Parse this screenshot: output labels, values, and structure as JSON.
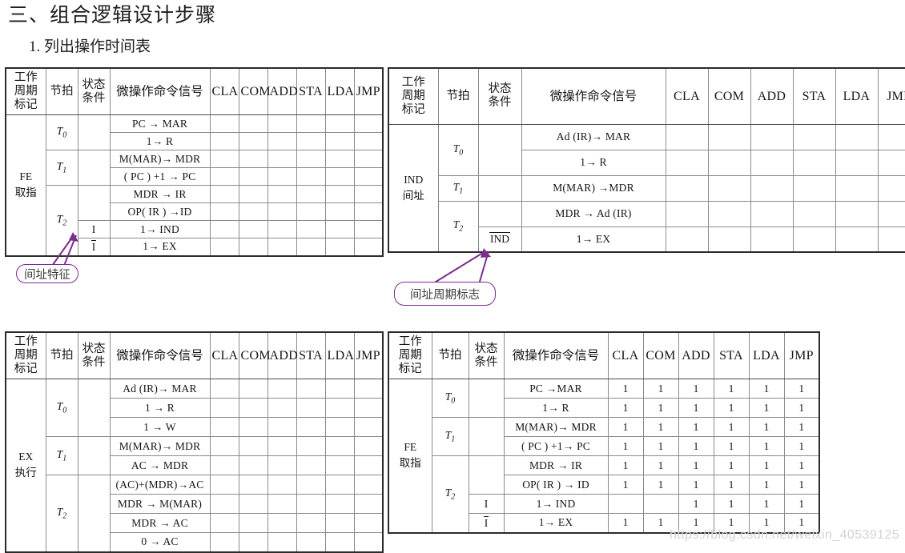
{
  "headings": {
    "main": "三、组合逻辑设计步骤",
    "sub": "1. 列出操作时间表"
  },
  "watermark": "https://blog.csdn.net/weixin_40539125",
  "accent_color": "#7b2d8e",
  "beat_color": "#2240c8",
  "common_headers": {
    "cycle": "工作\n周期\n标记",
    "cycle_l1": "工作",
    "cycle_l2": "周期",
    "cycle_l3": "标记",
    "beat": "节拍",
    "cond_l1": "状态",
    "cond_l2": "条件",
    "signal": "微操作命令信号",
    "instructions": [
      "CLA",
      "COM",
      "ADD",
      "STA",
      "LDA",
      "JMP"
    ]
  },
  "tables": [
    {
      "id": "fe-blank",
      "cycle_label_l1": "FE",
      "cycle_label_l2": "取指",
      "beats": [
        {
          "beat": "T",
          "beat_sub": "0",
          "rows": [
            {
              "cond": "",
              "signal": "PC → MAR",
              "values": [
                "",
                "",
                "",
                "",
                "",
                ""
              ]
            },
            {
              "cond": "",
              "signal": "1→ R",
              "values": [
                "",
                "",
                "",
                "",
                "",
                ""
              ]
            }
          ]
        },
        {
          "beat": "T",
          "beat_sub": "1",
          "rows": [
            {
              "cond": "",
              "signal": "M(MAR)→ MDR",
              "values": [
                "",
                "",
                "",
                "",
                "",
                ""
              ]
            },
            {
              "cond": "",
              "signal": "( PC ) +1 → PC",
              "values": [
                "",
                "",
                "",
                "",
                "",
                ""
              ]
            }
          ]
        },
        {
          "beat": "T",
          "beat_sub": "2",
          "rows": [
            {
              "cond": "",
              "signal": "MDR → IR",
              "values": [
                "",
                "",
                "",
                "",
                "",
                ""
              ]
            },
            {
              "cond": "",
              "signal": "OP( IR ) →ID",
              "values": [
                "",
                "",
                "",
                "",
                "",
                ""
              ]
            },
            {
              "cond": "I",
              "signal": "1→ IND",
              "values": [
                "",
                "",
                "",
                "",
                "",
                ""
              ]
            },
            {
              "cond": "I",
              "cond_overline": true,
              "signal": "1→ EX",
              "values": [
                "",
                "",
                "",
                "",
                "",
                ""
              ]
            }
          ]
        }
      ]
    },
    {
      "id": "ind-blank",
      "cycle_label_l1": "IND",
      "cycle_label_l2": "间址",
      "beats": [
        {
          "beat": "T",
          "beat_sub": "0",
          "rows": [
            {
              "cond": "",
              "signal": "Ad (IR)→ MAR",
              "values": [
                "",
                "",
                "",
                "",
                "",
                ""
              ]
            },
            {
              "cond": "",
              "signal": "1→ R",
              "values": [
                "",
                "",
                "",
                "",
                "",
                ""
              ]
            }
          ]
        },
        {
          "beat": "T",
          "beat_sub": "1",
          "rows": [
            {
              "cond": "",
              "signal": "M(MAR) →MDR",
              "values": [
                "",
                "",
                "",
                "",
                "",
                ""
              ]
            }
          ]
        },
        {
          "beat": "T",
          "beat_sub": "2",
          "rows": [
            {
              "cond": "",
              "signal": "MDR → Ad (IR)",
              "values": [
                "",
                "",
                "",
                "",
                "",
                ""
              ]
            },
            {
              "cond": "IND",
              "cond_overline": true,
              "signal": "1→ EX",
              "values": [
                "",
                "",
                "",
                "",
                "",
                ""
              ]
            }
          ]
        }
      ]
    },
    {
      "id": "ex-blank",
      "cycle_label_l1": "EX",
      "cycle_label_l2": "执行",
      "beats": [
        {
          "beat": "T",
          "beat_sub": "0",
          "rows": [
            {
              "cond": "",
              "signal": "Ad (IR)→ MAR",
              "values": [
                "",
                "",
                "",
                "",
                "",
                ""
              ]
            },
            {
              "cond": "",
              "signal": "1 → R",
              "values": [
                "",
                "",
                "",
                "",
                "",
                ""
              ]
            },
            {
              "cond": "",
              "signal": "1 → W",
              "values": [
                "",
                "",
                "",
                "",
                "",
                ""
              ]
            }
          ]
        },
        {
          "beat": "T",
          "beat_sub": "1",
          "rows": [
            {
              "cond": "",
              "signal": "M(MAR)→ MDR",
              "values": [
                "",
                "",
                "",
                "",
                "",
                ""
              ]
            },
            {
              "cond": "",
              "signal": "AC → MDR",
              "values": [
                "",
                "",
                "",
                "",
                "",
                ""
              ]
            }
          ]
        },
        {
          "beat": "T",
          "beat_sub": "2",
          "rows": [
            {
              "cond": "",
              "signal": "(AC)+(MDR)→AC",
              "values": [
                "",
                "",
                "",
                "",
                "",
                ""
              ]
            },
            {
              "cond": "",
              "signal": "MDR → M(MAR)",
              "values": [
                "",
                "",
                "",
                "",
                "",
                ""
              ]
            },
            {
              "cond": "",
              "signal": "MDR → AC",
              "values": [
                "",
                "",
                "",
                "",
                "",
                ""
              ]
            },
            {
              "cond": "",
              "signal": "0 → AC",
              "values": [
                "",
                "",
                "",
                "",
                "",
                ""
              ]
            }
          ]
        }
      ]
    },
    {
      "id": "fe-filled",
      "cycle_label_l1": "FE",
      "cycle_label_l2": "取指",
      "beats": [
        {
          "beat": "T",
          "beat_sub": "0",
          "rows": [
            {
              "cond": "",
              "signal": "PC →MAR",
              "values": [
                "1",
                "1",
                "1",
                "1",
                "1",
                "1"
              ]
            },
            {
              "cond": "",
              "signal": "1→ R",
              "values": [
                "1",
                "1",
                "1",
                "1",
                "1",
                "1"
              ]
            }
          ]
        },
        {
          "beat": "T",
          "beat_sub": "1",
          "rows": [
            {
              "cond": "",
              "signal": "M(MAR)→ MDR",
              "values": [
                "1",
                "1",
                "1",
                "1",
                "1",
                "1"
              ]
            },
            {
              "cond": "",
              "signal": "( PC ) +1→ PC",
              "values": [
                "1",
                "1",
                "1",
                "1",
                "1",
                "1"
              ]
            }
          ]
        },
        {
          "beat": "T",
          "beat_sub": "2",
          "rows": [
            {
              "cond": "",
              "signal": "MDR → IR",
              "values": [
                "1",
                "1",
                "1",
                "1",
                "1",
                "1"
              ]
            },
            {
              "cond": "",
              "signal": "OP( IR ) → ID",
              "values": [
                "1",
                "1",
                "1",
                "1",
                "1",
                "1"
              ]
            },
            {
              "cond": "I",
              "signal": "1→ IND",
              "values": [
                "",
                "",
                "1",
                "1",
                "1",
                "1"
              ]
            },
            {
              "cond": "I",
              "cond_overline": true,
              "signal": "1→ EX",
              "values": [
                "1",
                "1",
                "1",
                "1",
                "1",
                "1"
              ]
            }
          ]
        }
      ]
    }
  ],
  "callouts": [
    {
      "id": "ind-feature",
      "label": "间址特征"
    },
    {
      "id": "ind-cycle-flag",
      "label": "间址周期标志"
    }
  ]
}
